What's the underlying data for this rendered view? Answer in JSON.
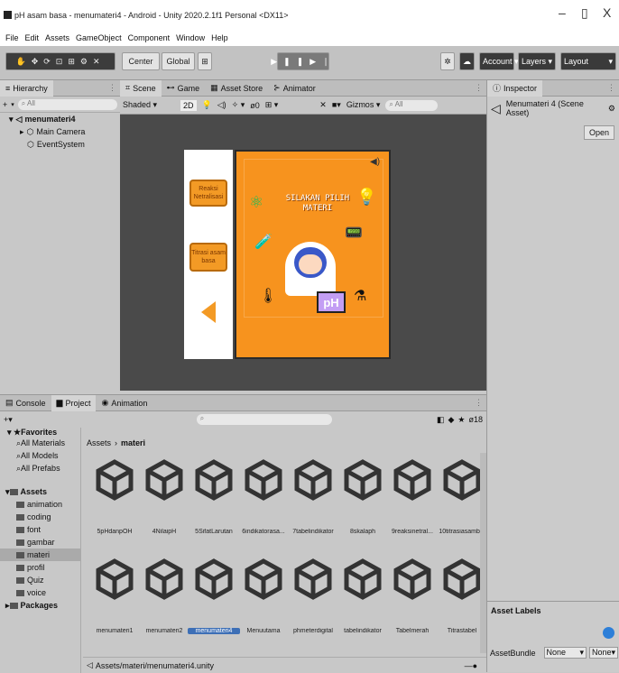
{
  "window": {
    "title": "pH asam basa - menumateri4 - Android - Unity 2020.2.1f1 Personal <DX11>",
    "minimize": "–",
    "maximize": "▯",
    "close": "X"
  },
  "menu": [
    "File",
    "Edit",
    "Assets",
    "GameObject",
    "Component",
    "Window",
    "Help"
  ],
  "toolbar": {
    "center": "Center",
    "global": "Global",
    "account": "Account",
    "layers": "Layers",
    "layout": "Layout"
  },
  "hierarchy": {
    "tab": "Hierarchy",
    "search": "All",
    "plus": "+",
    "scene": "menumateri4",
    "items": [
      "Main Camera",
      "EventSystem"
    ]
  },
  "scene": {
    "tabs": [
      "Scene",
      "Game",
      "Asset Store",
      "Animator"
    ],
    "shading": "Shaded",
    "mode2d": "2D",
    "gizmos": "Gizmos",
    "search": "All",
    "game": {
      "btn1": "Reaksi Netralisasi",
      "btn2": "Titrasi asam basa",
      "heading": "SILAKAN PILIH MATERI",
      "ph": "pH"
    }
  },
  "inspector": {
    "tab": "Inspector",
    "title": "Menumateri 4 (Scene Asset)",
    "open": "Open",
    "labels": "Asset Labels",
    "bundle": "AssetBundle",
    "bundle_val": "None",
    "variant": "None"
  },
  "project": {
    "tabs": [
      "Console",
      "Project",
      "Animation"
    ],
    "count": "18",
    "favorites": "Favorites",
    "fav_items": [
      "All Materials",
      "All Models",
      "All Prefabs"
    ],
    "assets_root": "Assets",
    "folders": [
      "animation",
      "coding",
      "font",
      "gambar",
      "materi",
      "profil",
      "Quiz",
      "voice"
    ],
    "packages": "Packages",
    "breadcrumb": [
      "Assets",
      "materi"
    ],
    "row1": [
      "5pHdanpOH",
      "4NilaipH",
      "5SifatLarutan",
      "6indikatorasa...",
      "7tabelindikator",
      "8skalaph",
      "9reaksinetral...",
      "10titrasiasamb..."
    ],
    "row2": [
      "menumateri1",
      "menumateri2",
      "menumateri4",
      "Menuutama",
      "phmeterdigital",
      "tabelindikator",
      "Tabelmerah",
      "Titrastabel"
    ],
    "path": "Assets/materi/menumateri4.unity"
  }
}
